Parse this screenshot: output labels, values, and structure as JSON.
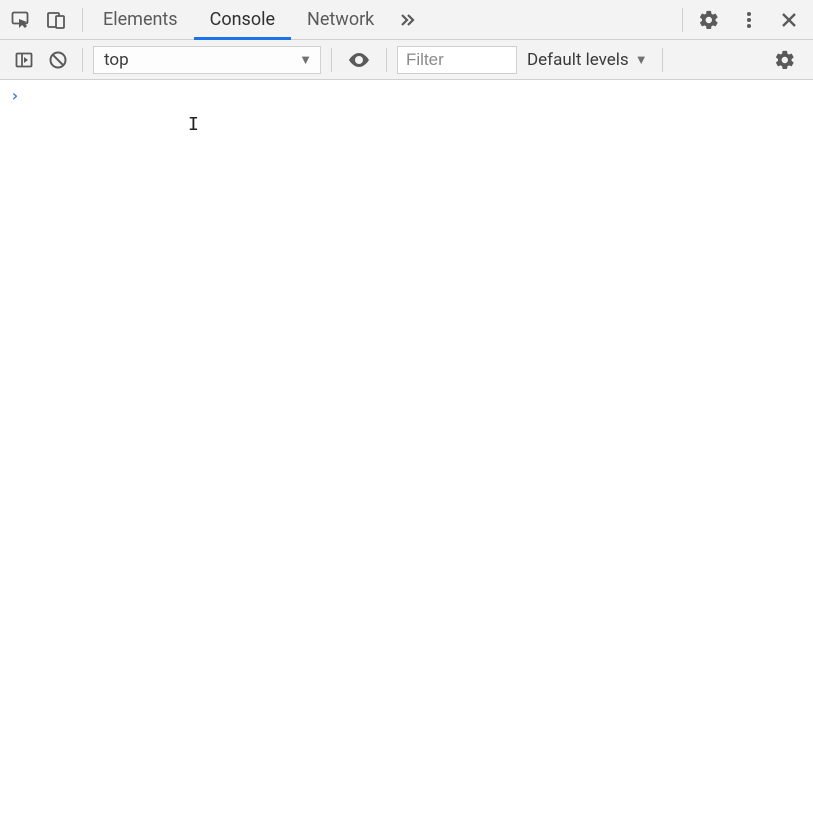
{
  "tabs": {
    "elements": "Elements",
    "console": "Console",
    "network": "Network"
  },
  "subbar": {
    "context_selected": "top",
    "filter_placeholder": "Filter",
    "levels_label": "Default levels"
  },
  "console": {
    "prompt_symbol": "›"
  }
}
